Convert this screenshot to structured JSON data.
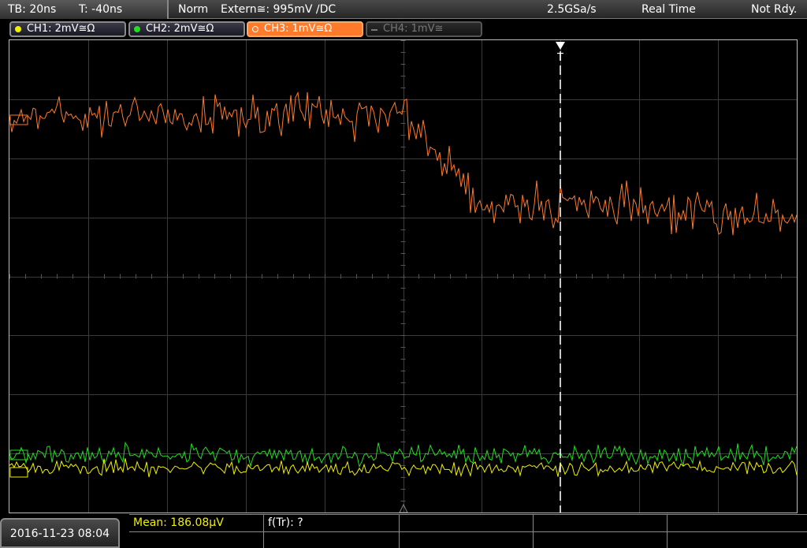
{
  "top": {
    "timebase": "TB: 20ns",
    "trigger_offset": "T: -40ns",
    "trigger_mode": "Norm",
    "trigger_source": "Extern≅: 995mV ∕DC",
    "sample_rate": "2.5GSa/s",
    "acq_mode": "Real Time",
    "status": "Not Rdy."
  },
  "channels": [
    {
      "label": "CH1: 2mV≅Ω",
      "color": "#f0f000",
      "active": true
    },
    {
      "label": "CH2: 2mV≅Ω",
      "color": "#22dd22",
      "active": true
    },
    {
      "label": "CH3: 1mV≅Ω",
      "color": "#ff7a2a",
      "active": true
    },
    {
      "label": "CH4: 1mV≅",
      "color": "#777777",
      "active": false
    }
  ],
  "measurement": {
    "mean": "Mean: 186.08µV",
    "ftr": "f(Tr): ?"
  },
  "datetime": "2016-11-23 08:04",
  "trigger_marker": "T"
}
